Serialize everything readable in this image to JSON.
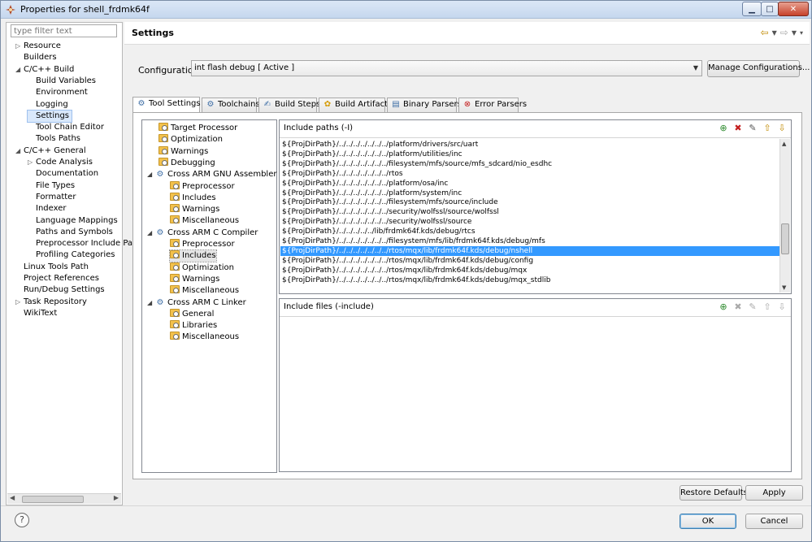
{
  "window": {
    "title": "Properties for shell_frdmk64f"
  },
  "filter": {
    "placeholder": "type filter text"
  },
  "left_tree": [
    {
      "label": "Resource",
      "level": 1,
      "expander": "▷"
    },
    {
      "label": "Builders",
      "level": 1,
      "expander": ""
    },
    {
      "label": "C/C++ Build",
      "level": 1,
      "expander": "◢"
    },
    {
      "label": "Build Variables",
      "level": 2,
      "expander": ""
    },
    {
      "label": "Environment",
      "level": 2,
      "expander": ""
    },
    {
      "label": "Logging",
      "level": 2,
      "expander": ""
    },
    {
      "label": "Settings",
      "level": 2,
      "expander": "",
      "selected": true
    },
    {
      "label": "Tool Chain Editor",
      "level": 2,
      "expander": ""
    },
    {
      "label": "Tools Paths",
      "level": 2,
      "expander": ""
    },
    {
      "label": "C/C++ General",
      "level": 1,
      "expander": "◢"
    },
    {
      "label": "Code Analysis",
      "level": 2,
      "expander": "▷"
    },
    {
      "label": "Documentation",
      "level": 2,
      "expander": ""
    },
    {
      "label": "File Types",
      "level": 2,
      "expander": ""
    },
    {
      "label": "Formatter",
      "level": 2,
      "expander": ""
    },
    {
      "label": "Indexer",
      "level": 2,
      "expander": ""
    },
    {
      "label": "Language Mappings",
      "level": 2,
      "expander": ""
    },
    {
      "label": "Paths and Symbols",
      "level": 2,
      "expander": ""
    },
    {
      "label": "Preprocessor Include Pa",
      "level": 2,
      "expander": ""
    },
    {
      "label": "Profiling Categories",
      "level": 2,
      "expander": ""
    },
    {
      "label": "Linux Tools Path",
      "level": 1,
      "expander": ""
    },
    {
      "label": "Project References",
      "level": 1,
      "expander": ""
    },
    {
      "label": "Run/Debug Settings",
      "level": 1,
      "expander": ""
    },
    {
      "label": "Task Repository",
      "level": 1,
      "expander": "▷"
    },
    {
      "label": "WikiText",
      "level": 1,
      "expander": ""
    }
  ],
  "header": {
    "title": "Settings"
  },
  "config": {
    "label": "Configuration:",
    "value": "int flash debug  [ Active ]",
    "manage_label": "Manage Configurations..."
  },
  "tabs": [
    {
      "label": "Tool Settings",
      "icon": "gear-icon",
      "active": true
    },
    {
      "label": "Toolchains",
      "icon": "gear-icon"
    },
    {
      "label": "Build Steps",
      "icon": "build-steps-icon"
    },
    {
      "label": "Build Artifact",
      "icon": "artifact-icon"
    },
    {
      "label": "Binary Parsers",
      "icon": "binary-parser-icon"
    },
    {
      "label": "Error Parsers",
      "icon": "error-icon"
    }
  ],
  "tool_tree": [
    {
      "label": "Target Processor",
      "level": 1,
      "kind": "folder"
    },
    {
      "label": "Optimization",
      "level": 1,
      "kind": "folder"
    },
    {
      "label": "Warnings",
      "level": 1,
      "kind": "folder"
    },
    {
      "label": "Debugging",
      "level": 1,
      "kind": "folder"
    },
    {
      "label": "Cross ARM GNU Assembler",
      "level": 0,
      "kind": "tool"
    },
    {
      "label": "Preprocessor",
      "level": 2,
      "kind": "folder"
    },
    {
      "label": "Includes",
      "level": 2,
      "kind": "folder"
    },
    {
      "label": "Warnings",
      "level": 2,
      "kind": "folder"
    },
    {
      "label": "Miscellaneous",
      "level": 2,
      "kind": "folder"
    },
    {
      "label": "Cross ARM C Compiler",
      "level": 0,
      "kind": "tool"
    },
    {
      "label": "Preprocessor",
      "level": 2,
      "kind": "folder"
    },
    {
      "label": "Includes",
      "level": 2,
      "kind": "folder",
      "selected": true
    },
    {
      "label": "Optimization",
      "level": 2,
      "kind": "folder"
    },
    {
      "label": "Warnings",
      "level": 2,
      "kind": "folder"
    },
    {
      "label": "Miscellaneous",
      "level": 2,
      "kind": "folder"
    },
    {
      "label": "Cross ARM C Linker",
      "level": 0,
      "kind": "tool"
    },
    {
      "label": "General",
      "level": 2,
      "kind": "folder"
    },
    {
      "label": "Libraries",
      "level": 2,
      "kind": "folder"
    },
    {
      "label": "Miscellaneous",
      "level": 2,
      "kind": "folder"
    }
  ],
  "include_paths": {
    "title": "Include paths (-I)",
    "items": [
      "${ProjDirPath}/../../../../../../../platform/drivers/src/uart",
      "${ProjDirPath}/../../../../../../../platform/utilities/inc",
      "${ProjDirPath}/../../../../../../../filesystem/mfs/source/mfs_sdcard/nio_esdhc",
      "${ProjDirPath}/../../../../../../../rtos",
      "${ProjDirPath}/../../../../../../../platform/osa/inc",
      "${ProjDirPath}/../../../../../../../platform/system/inc",
      "${ProjDirPath}/../../../../../../../filesystem/mfs/source/include",
      "${ProjDirPath}/../../../../../../../security/wolfssl/source/wolfssl",
      "${ProjDirPath}/../../../../../../../security/wolfssl/source",
      "${ProjDirPath}/../../../../../lib/frdmk64f.kds/debug/rtcs",
      "${ProjDirPath}/../../../../../../../filesystem/mfs/lib/frdmk64f.kds/debug/mfs",
      "${ProjDirPath}/../../../../../../../rtos/mqx/lib/frdmk64f.kds/debug/nshell",
      "${ProjDirPath}/../../../../../../../rtos/mqx/lib/frdmk64f.kds/debug/config",
      "${ProjDirPath}/../../../../../../../rtos/mqx/lib/frdmk64f.kds/debug/mqx",
      "${ProjDirPath}/../../../../../../../rtos/mqx/lib/frdmk64f.kds/debug/mqx_stdlib"
    ],
    "selected_index": 11
  },
  "include_files": {
    "title": "Include files (-include)"
  },
  "buttons": {
    "restore": "Restore Defaults",
    "apply": "Apply",
    "ok": "OK",
    "cancel": "Cancel"
  },
  "colors": {
    "selection": "#3399ff",
    "accent": "#c08a00"
  }
}
